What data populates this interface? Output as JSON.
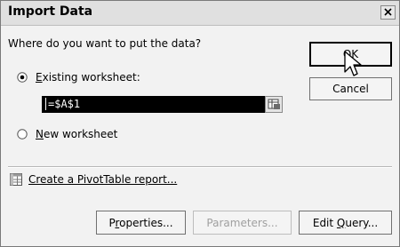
{
  "dialog": {
    "title": "Import Data",
    "prompt": "Where do you want to put the data?",
    "options": {
      "existing_label_pre": "",
      "existing_label_accel": "E",
      "existing_label_post": "xisting worksheet:",
      "existing_checked": true,
      "new_label_pre": "",
      "new_label_accel": "N",
      "new_label_post": "ew worksheet",
      "new_checked": false
    },
    "reference_value": "=$A$1",
    "pivot_link": "Create a PivotTable report...",
    "buttons": {
      "ok": "OK",
      "cancel": "Cancel",
      "properties_pre": "P",
      "properties_accel": "r",
      "properties_post": "operties...",
      "parameters": "Parameters...",
      "edit_query_pre": "Edit ",
      "edit_query_accel": "Q",
      "edit_query_post": "uery..."
    },
    "icons": {
      "close": "close-icon",
      "collapse": "range-collapse-icon",
      "pivot": "pivottable-icon",
      "cursor": "mouse-pointer-icon"
    }
  }
}
